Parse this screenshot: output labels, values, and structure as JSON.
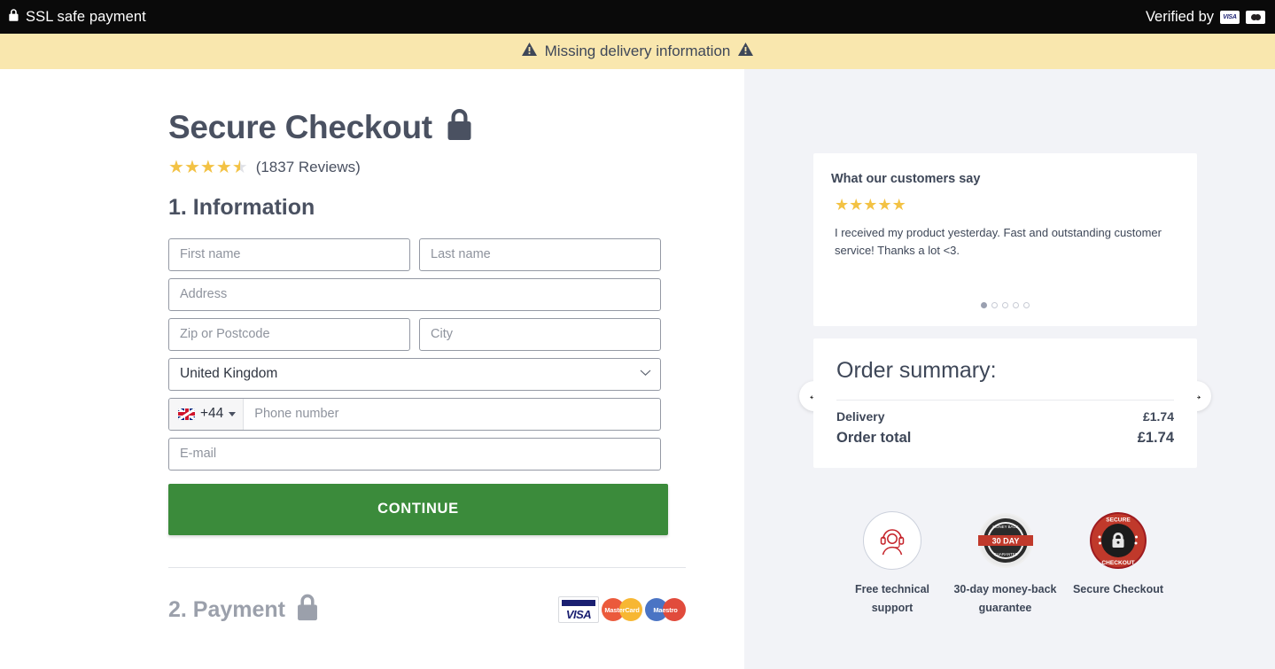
{
  "topbar": {
    "ssl_label": "SSL safe payment",
    "lock_icon": "lock-icon",
    "verified_label": "Verified by",
    "visa_text": "VISA",
    "mc_securecode": "SecureCode"
  },
  "warning": {
    "text": "Missing delivery information",
    "icon_left": "warning-triangle-icon",
    "icon_right": "warning-triangle-icon",
    "bg_color": "#f9e7ae",
    "text_color": "#3e4758"
  },
  "main": {
    "title": "Secure Checkout",
    "title_lock_icon": "lock-icon",
    "rating": {
      "value": 4.5,
      "max": 5,
      "reviews_label": "(1837 Reviews)",
      "star_color": "#f3c244"
    },
    "step1_title": "1. Information",
    "form": {
      "first_name_placeholder": "First name",
      "last_name_placeholder": "Last name",
      "address_placeholder": "Address",
      "zip_placeholder": "Zip or Postcode",
      "city_placeholder": "City",
      "country_selected": "United Kingdom",
      "phone_dial_code": "+44",
      "phone_flag": "uk-flag-icon",
      "phone_placeholder": "Phone number",
      "email_placeholder": "E-mail"
    },
    "continue_label": "CONTINUE",
    "continue_color": "#3b8b3b",
    "step2_title": "2. Payment",
    "step2_lock_icon": "lock-icon",
    "card_logos": [
      {
        "name": "visa-logo",
        "text": "VISA"
      },
      {
        "name": "mastercard-logo",
        "text": "MasterCard"
      },
      {
        "name": "maestro-logo",
        "text": "Maestro"
      }
    ]
  },
  "sidebar": {
    "testimonial": {
      "heading": "What our customers say",
      "stars": 5,
      "quote": "I received my product yesterday. Fast and outstanding customer service! Thanks a lot <3.",
      "prev_icon": "arrow-left-icon",
      "next_icon": "arrow-right-icon",
      "dots_total": 5,
      "dots_active_index": 0
    },
    "order_summary": {
      "title": "Order summary:",
      "rows": [
        {
          "label": "Delivery",
          "value": "£1.74"
        },
        {
          "label": "Order total",
          "value": "£1.74"
        }
      ]
    },
    "trust_badges": [
      {
        "icon": "headset-support-icon",
        "label": "Free technical support"
      },
      {
        "icon": "money-back-30-day-icon",
        "label": "30-day money-back guarantee"
      },
      {
        "icon": "secure-checkout-seal-icon",
        "label": "Secure Checkout"
      }
    ]
  }
}
